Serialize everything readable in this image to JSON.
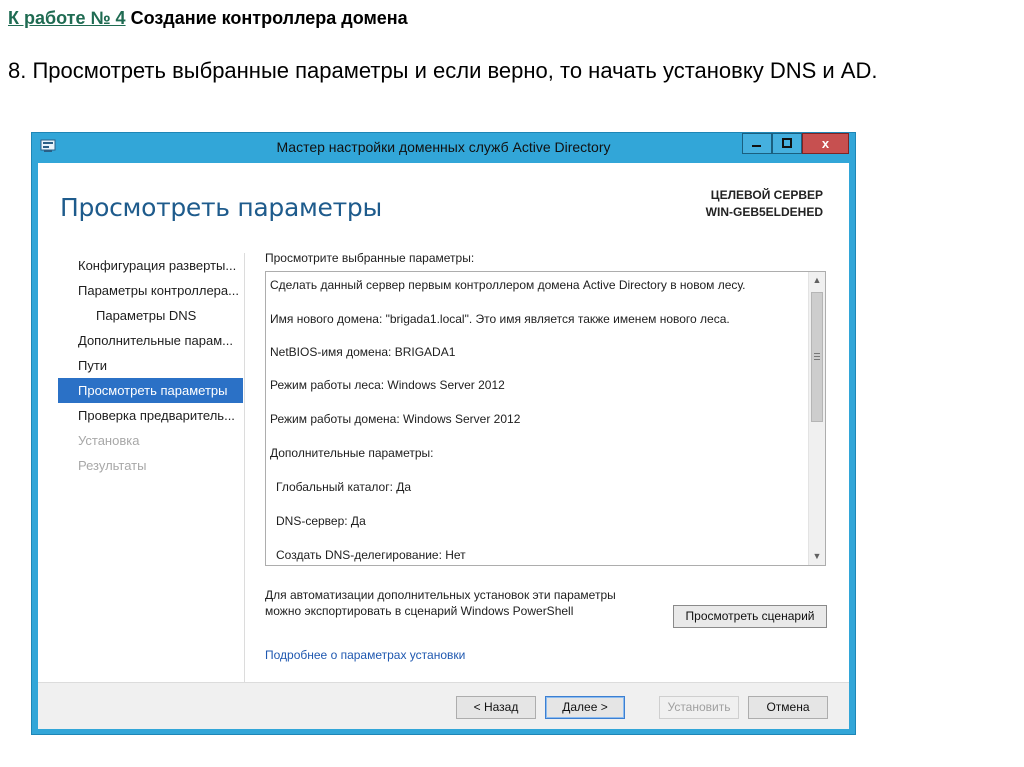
{
  "slide": {
    "header_link": "К работе № 4",
    "header_title": " Создание контроллера домена",
    "instruction": "8. Просмотреть выбранные параметры и если верно, то начать установку DNS и AD."
  },
  "window": {
    "title": "Мастер настройки доменных служб Active Directory",
    "close_symbol": "x",
    "page_title": "Просмотреть параметры",
    "target_label": "ЦЕЛЕВОЙ СЕРВЕР",
    "target_name": "WIN-GEB5ELDEHED"
  },
  "nav": {
    "items": [
      "Конфигурация разверты...",
      "Параметры контроллера...",
      "Параметры DNS",
      "Дополнительные парам...",
      "Пути",
      "Просмотреть параметры",
      "Проверка предваритель...",
      "Установка",
      "Результаты"
    ]
  },
  "review": {
    "label": "Просмотрите выбранные параметры:",
    "lines": [
      "Сделать данный сервер первым контроллером домена Active Directory в новом лесу.",
      "Имя нового домена: \"brigada1.local\". Это имя является также именем нового леса.",
      "NetBIOS-имя домена: BRIGADA1",
      "Режим работы леса: Windows Server 2012",
      "Режим работы домена: Windows Server 2012",
      "Дополнительные параметры:",
      "Глобальный каталог: Да",
      "DNS-сервер: Да",
      "Создать DNS-делегирование: Нет"
    ]
  },
  "export": {
    "line1": "Для автоматизации дополнительных установок эти параметры",
    "line2": "можно экспортировать в сценарий Windows PowerShell",
    "button": "Просмотреть сценарий"
  },
  "more_link": "Подробнее о параметрах установки",
  "buttons": {
    "back": "< Назад",
    "next": "Далее >",
    "install": "Установить",
    "cancel": "Отмена"
  }
}
